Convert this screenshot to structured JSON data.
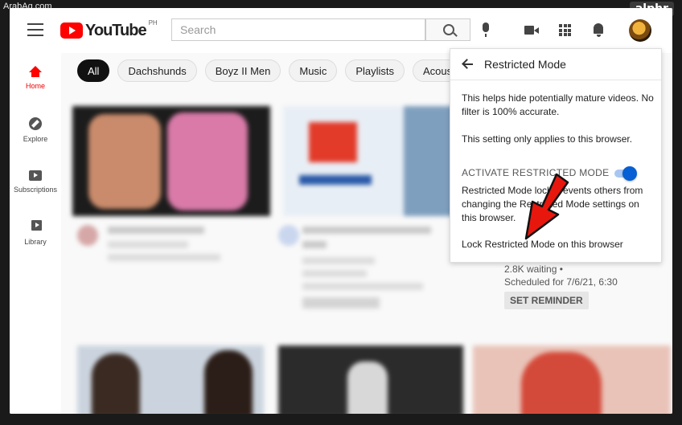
{
  "watermark": "ArabAq.com",
  "badge": "alphr",
  "header": {
    "logo_text": "YouTube",
    "region": "PH",
    "search_placeholder": "Search"
  },
  "sidebar": {
    "items": [
      {
        "label": "Home",
        "icon": "home-icon"
      },
      {
        "label": "Explore",
        "icon": "explore-icon"
      },
      {
        "label": "Subscriptions",
        "icon": "subscriptions-icon"
      },
      {
        "label": "Library",
        "icon": "library-icon"
      }
    ]
  },
  "chips": [
    "All",
    "Dachshunds",
    "Boyz II Men",
    "Music",
    "Playlists",
    "Acoustic g"
  ],
  "video": {
    "waiting": "2.8K waiting •",
    "scheduled": "Scheduled for 7/6/21, 6:30",
    "reminder_label": "SET REMINDER"
  },
  "panel": {
    "title": "Restricted Mode",
    "desc1": "This helps hide potentially mature videos. No filter is 100% accurate.",
    "desc2": "This setting only applies to this browser.",
    "activate_label": "ACTIVATE RESTRICTED MODE",
    "toggle_on": true,
    "desc3": "Restricted Mode lock prevents others from changing the Restricted Mode settings on this browser.",
    "lock_link": "Lock Restricted Mode on this browser"
  },
  "colors": {
    "brand_red": "#ff0000",
    "toggle_blue": "#065fd4",
    "arrow_red": "#e8170e"
  }
}
